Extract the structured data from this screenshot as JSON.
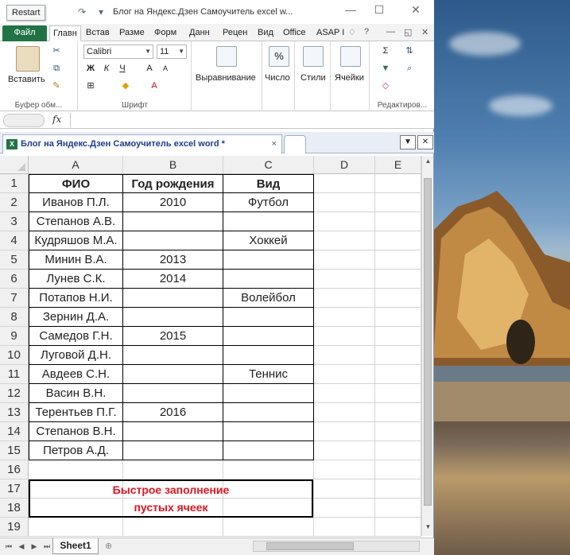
{
  "title_bar": {
    "restart_tooltip": "Restart",
    "window_title": "Блог на Яндекс.Дзен Самоучитель excel w...",
    "minimize": "—",
    "maximize": "☐",
    "close": "✕"
  },
  "ribbon_tabs": {
    "file": "Файл",
    "items": [
      "Главн",
      "Встав",
      "Разме",
      "Форм",
      "Данн",
      "Рецен",
      "Вид",
      "Office",
      "ASAP I"
    ]
  },
  "ribbon": {
    "clipboard": {
      "paste_label": "Вставить",
      "group_label": "Буфер обм..."
    },
    "font": {
      "font_name": "Calibri",
      "font_size": "11",
      "bold": "Ж",
      "italic": "К",
      "underline": "Ч",
      "group_label": "Шрифт"
    },
    "alignment": {
      "label": "Выравнивание"
    },
    "number": {
      "label": "Число",
      "symbol": "%"
    },
    "styles": {
      "label": "Стили"
    },
    "cells": {
      "label": "Ячейки"
    },
    "editing": {
      "group_label": "Редактиров..."
    }
  },
  "formula_bar": {
    "fx_label": "fx",
    "value": ""
  },
  "workbook_tab": {
    "title": "Блог на Яндекс.Дзен Самоучитель excel word *",
    "close": "×"
  },
  "columns": [
    "A",
    "B",
    "C",
    "D",
    "E"
  ],
  "rows": [
    {
      "n": "1",
      "a": "ФИО",
      "b": "Год рождения",
      "c": "Вид"
    },
    {
      "n": "2",
      "a": "Иванов П.Л.",
      "b": "2010",
      "c": "Футбол"
    },
    {
      "n": "3",
      "a": "Степанов А.В.",
      "b": "",
      "c": ""
    },
    {
      "n": "4",
      "a": "Кудряшов М.А.",
      "b": "",
      "c": "Хоккей"
    },
    {
      "n": "5",
      "a": "Минин В.А.",
      "b": "2013",
      "c": ""
    },
    {
      "n": "6",
      "a": "Лунев С.К.",
      "b": "2014",
      "c": ""
    },
    {
      "n": "7",
      "a": "Потапов Н.И.",
      "b": "",
      "c": "Волейбол"
    },
    {
      "n": "8",
      "a": "Зернин Д.А.",
      "b": "",
      "c": ""
    },
    {
      "n": "9",
      "a": "Самедов Г.Н.",
      "b": "2015",
      "c": ""
    },
    {
      "n": "10",
      "a": "Луговой Д.Н.",
      "b": "",
      "c": ""
    },
    {
      "n": "11",
      "a": "Авдеев С.Н.",
      "b": "",
      "c": "Теннис"
    },
    {
      "n": "12",
      "a": "Васин В.Н.",
      "b": "",
      "c": ""
    },
    {
      "n": "13",
      "a": "Терентьев П.Г.",
      "b": "2016",
      "c": ""
    },
    {
      "n": "14",
      "a": "Степанов В.Н.",
      "b": "",
      "c": ""
    },
    {
      "n": "15",
      "a": "Петров А.Д.",
      "b": "",
      "c": ""
    },
    {
      "n": "16",
      "a": "",
      "b": "",
      "c": ""
    },
    {
      "n": "17",
      "a": "",
      "b": "",
      "c": ""
    },
    {
      "n": "18",
      "a": "",
      "b": "",
      "c": ""
    },
    {
      "n": "19",
      "a": "",
      "b": "",
      "c": ""
    }
  ],
  "note": {
    "line1": "Быстрое заполнение",
    "line2": "пустых ячеек",
    "color": "#e0141e"
  },
  "sheet_tabs": {
    "active": "Sheet1"
  },
  "accent_color": "#217346"
}
